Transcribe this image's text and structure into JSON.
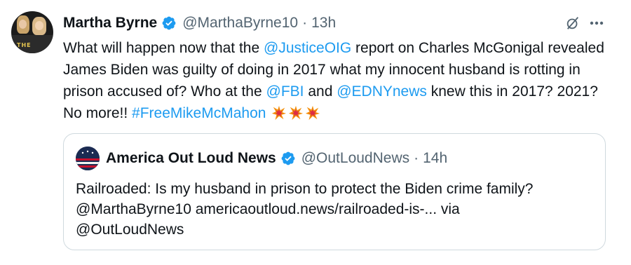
{
  "tweet": {
    "author_name": "Martha Byrne",
    "author_handle": "@MarthaByrne10",
    "separator": "·",
    "time": "13h",
    "text": {
      "t1": "What will happen now that the ",
      "mention_oig": "@JusticeOIG",
      "t2": " report on Charles McGonigal revealed James Biden was guilty of doing in 2017 what my innocent husband is rotting in prison accused of? Who at the ",
      "mention_fbi": "@FBI",
      "t3": " and ",
      "mention_edny": "@EDNYnews",
      "t4": " knew this in 2017? 2021? No more!! ",
      "hashtag": "#FreeMikeMcMahon"
    },
    "emoji_count": 3
  },
  "quote": {
    "author_name": "America Out Loud News",
    "author_handle": "@OutLoudNews",
    "separator": "·",
    "time": "14h",
    "text_line1": "Railroaded: Is my husband in prison to protect the Biden crime family?",
    "text_line2": "@MarthaByrne10 americaoutloud.news/railroaded-is-... via",
    "text_line3": "@OutLoudNews"
  },
  "colors": {
    "link": "#1d9bf0",
    "muted": "#536471",
    "text": "#0f1419",
    "border": "#cfd9de"
  },
  "icons": [
    "verified-badge-icon",
    "grok-icon",
    "more-options-icon",
    "collision-emoji-icon"
  ]
}
